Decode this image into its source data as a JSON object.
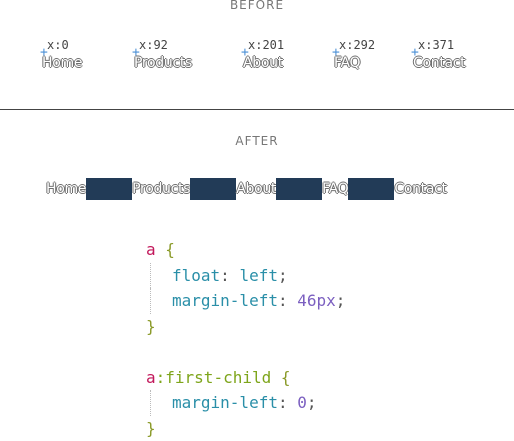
{
  "headings": {
    "before": "BEFORE",
    "after": "AFTER"
  },
  "before": {
    "items": [
      {
        "label": "Home",
        "coord": "x:0"
      },
      {
        "label": "Products",
        "coord": "x:92"
      },
      {
        "label": "About",
        "coord": "x:201"
      },
      {
        "label": "FAQ",
        "coord": "x:292"
      },
      {
        "label": "Contact",
        "coord": "x:371"
      }
    ],
    "marker_glyph": "+"
  },
  "after": {
    "items": [
      "Home",
      "Products",
      "About",
      "FAQ",
      "Contact"
    ]
  },
  "code": {
    "rule1": {
      "selector": "a",
      "open": "{",
      "decl1": {
        "prop": "float",
        "colon": ":",
        "value": "left",
        "end": ";"
      },
      "decl2": {
        "prop": "margin-left",
        "colon": ":",
        "value": "46px",
        "end": ";"
      },
      "close": "}"
    },
    "rule2": {
      "selector": "a",
      "pseudo": ":first-child",
      "open": "{",
      "decl1": {
        "prop": "margin-left",
        "colon": ":",
        "value": "0",
        "end": ";"
      },
      "close": "}"
    }
  },
  "colors": {
    "gap_box": "#223b57",
    "marker": "#4a8fd6",
    "selector": "#c2185b",
    "pseudo": "#7ea51b",
    "property": "#2a8fa8",
    "number": "#7b5fc0"
  }
}
